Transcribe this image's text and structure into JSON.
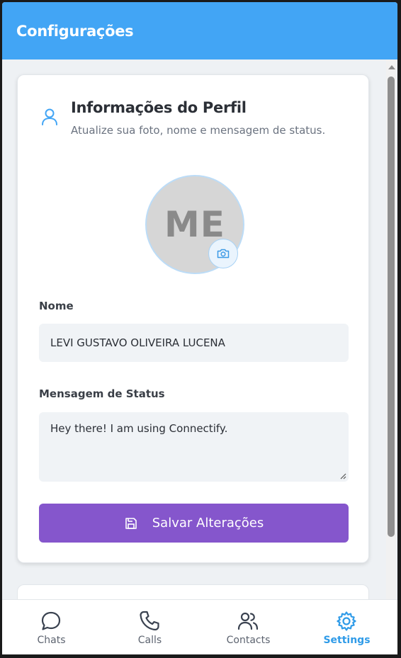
{
  "header": {
    "title": "Configurações"
  },
  "profile_card": {
    "title": "Informações do Perfil",
    "subtitle": "Atualize sua foto, nome e mensagem de status.",
    "avatar_initials": "ME",
    "name_label": "Nome",
    "name_value": "LEVI GUSTAVO OLIVEIRA LUCENA",
    "status_label": "Mensagem de Status",
    "status_value": "Hey there! I am using Connectify.",
    "save_label": "Salvar Alterações"
  },
  "bottom_nav": {
    "items": [
      {
        "label": "Chats",
        "icon": "chat-bubble-icon",
        "active": false
      },
      {
        "label": "Calls",
        "icon": "phone-icon",
        "active": false
      },
      {
        "label": "Contacts",
        "icon": "users-icon",
        "active": false
      },
      {
        "label": "Settings",
        "icon": "gear-icon",
        "active": true
      }
    ]
  },
  "colors": {
    "header": "#42a5f5",
    "accent": "#2f9be8",
    "save_button": "#8556cc"
  }
}
